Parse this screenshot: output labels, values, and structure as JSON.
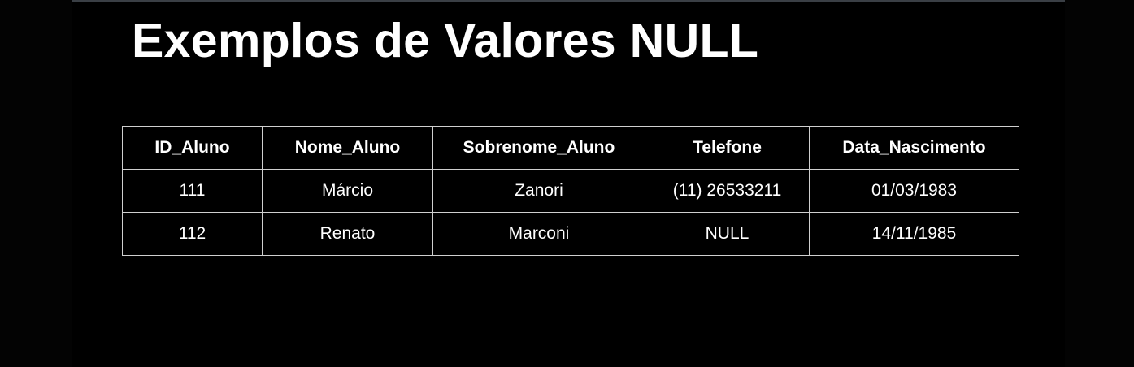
{
  "title": "Exemplos de Valores NULL",
  "table": {
    "headers": [
      "ID_Aluno",
      "Nome_Aluno",
      "Sobrenome_Aluno",
      "Telefone",
      "Data_Nascimento"
    ],
    "rows": [
      [
        "111",
        "Márcio",
        "Zanori",
        "(11) 26533211",
        "01/03/1983"
      ],
      [
        "112",
        "Renato",
        "Marconi",
        "NULL",
        "14/11/1985"
      ]
    ]
  }
}
